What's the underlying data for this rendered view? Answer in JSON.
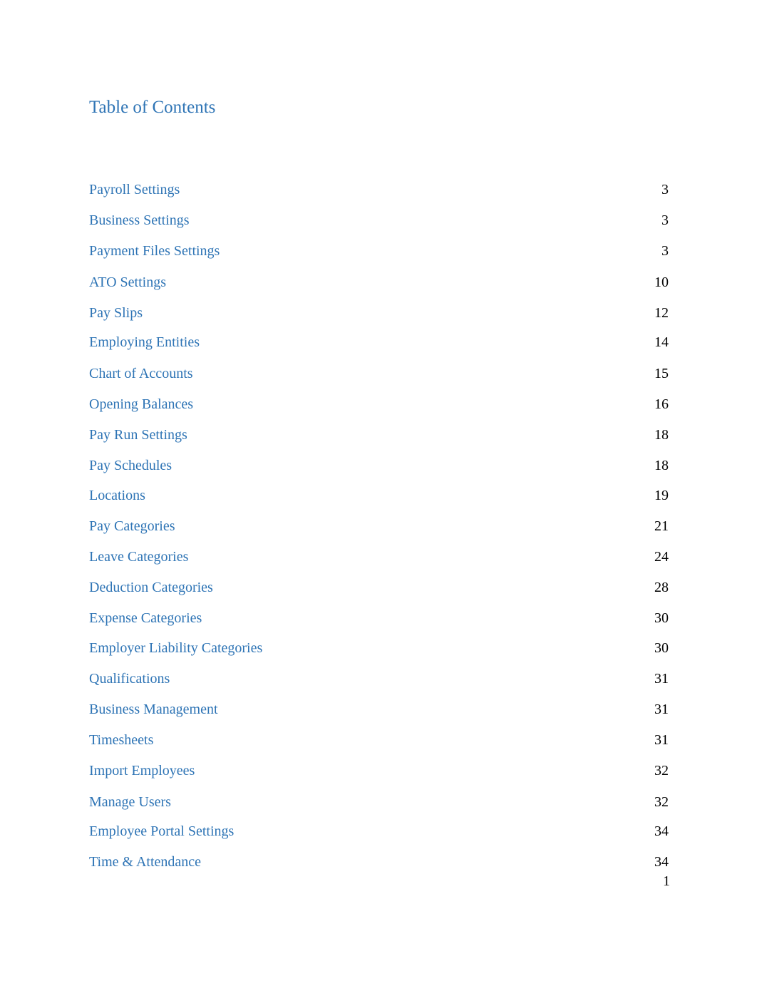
{
  "document": {
    "title": "Table of Contents",
    "accent_color": "#2E74B5",
    "entries": [
      {
        "label": "Payroll Settings",
        "page": "3"
      },
      {
        "label": "Business Settings",
        "page": "3"
      },
      {
        "label": "Payment Files Settings",
        "page": "3"
      },
      {
        "label": "ATO Settings",
        "page": "10"
      },
      {
        "label": "Pay Slips",
        "page": "12"
      },
      {
        "label": "Employing Entities",
        "page": "14"
      },
      {
        "label": "Chart of Accounts",
        "page": "15"
      },
      {
        "label": "Opening Balances",
        "page": "16"
      },
      {
        "label": "Pay Run Settings",
        "page": "18"
      },
      {
        "label": "Pay Schedules",
        "page": "18"
      },
      {
        "label": "Locations",
        "page": "19"
      },
      {
        "label": "Pay Categories",
        "page": "21"
      },
      {
        "label": "Leave Categories",
        "page": "24"
      },
      {
        "label": "Deduction Categories",
        "page": "28"
      },
      {
        "label": "Expense Categories",
        "page": "30"
      },
      {
        "label": "Employer Liability Categories",
        "page": "30"
      },
      {
        "label": "Qualifications",
        "page": "31"
      },
      {
        "label": "Business Management",
        "page": "31"
      },
      {
        "label": "Timesheets",
        "page": "31"
      },
      {
        "label": "Import Employees",
        "page": "32"
      },
      {
        "label": "Manage Users",
        "page": "32"
      },
      {
        "label": "Employee Portal Settings",
        "page": "34"
      },
      {
        "label": "Time & Attendance",
        "page": "34"
      }
    ],
    "page_number": "1"
  }
}
